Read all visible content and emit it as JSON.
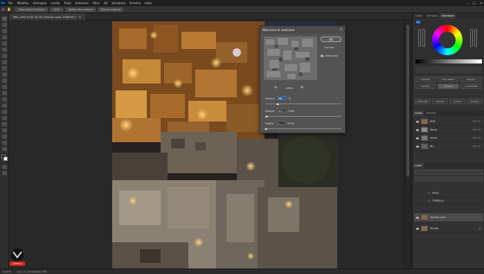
{
  "app": {
    "logo_text": "Ps"
  },
  "menu": [
    "File",
    "Modifica",
    "Immagine",
    "Livello",
    "Testo",
    "Selezione",
    "Filtro",
    "3D",
    "Visualizza",
    "Finestra",
    "Aiuto"
  ],
  "options_bar": {
    "zoom_percent": "100%",
    "btn_fit": "Zoom tutte le finestre",
    "btn_fill": "Adatta allo schermo",
    "btn_print": "Riempi schermo"
  },
  "document_tab": {
    "title": "IMG_1591.tif @ 16,7% (Sfondo copia, RGB/16) *",
    "close": "×"
  },
  "dialog": {
    "title": "Maschera di contrasto",
    "close": "×",
    "ok_label": "OK",
    "cancel_label": "Annulla",
    "preview_label": "Anteprima",
    "preview_checked": true,
    "zoom_value": "100%",
    "amount_label": "Fattore:",
    "amount_value": "80",
    "amount_unit": "%",
    "amount_fraction": 0.16,
    "radius_label": "Raggio:",
    "radius_value": "6,3",
    "radius_unit": "Pixel",
    "radius_fraction": 0.02,
    "threshold_label": "Soglia:",
    "threshold_value": "1",
    "threshold_unit": "livelli",
    "threshold_fraction": 0.01
  },
  "color_panel": {
    "tabs": [
      "Colore",
      "Campioni",
      "Sfumature"
    ],
    "active_tab": 2
  },
  "adjustment_buttons": [
    "Contrast",
    "Color Detect",
    "Saturaz.",
    "Opacità",
    "Unsharp",
    "Luminosità",
    "Soft Light",
    "Overlay",
    "Screen",
    "Multiply"
  ],
  "channels": {
    "tabs": [
      "Canali",
      "Tracciati"
    ],
    "rows": [
      {
        "name": "RGB",
        "shortcut": "Ctrl+2"
      },
      {
        "name": "Rosso",
        "shortcut": "Ctrl+3"
      },
      {
        "name": "Verde",
        "shortcut": "Ctrl+4"
      },
      {
        "name": "Blu",
        "shortcut": "Ctrl+5"
      }
    ]
  },
  "layers": {
    "tab": "Livelli",
    "rows": [
      {
        "name": "PROS",
        "type": "group"
      },
      {
        "name": "TURBOLA",
        "type": "group"
      },
      {
        "name": "Sfondo copia",
        "type": "pixel",
        "selected": true
      },
      {
        "name": "Sfondo",
        "type": "pixel",
        "selected": false
      }
    ]
  },
  "status": {
    "zoom": "16,67%",
    "doc": "Doc: 212,6 MB/283,5 MB"
  },
  "watermark": {
    "badge_text": "DIRETTA"
  }
}
